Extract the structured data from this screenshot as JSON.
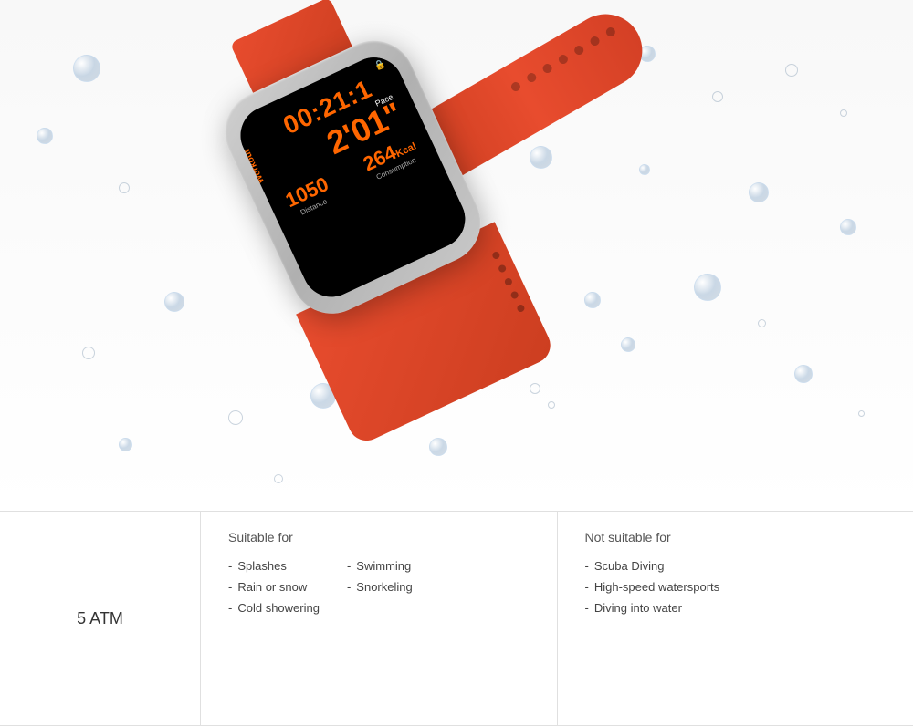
{
  "watch": {
    "screen": {
      "workout_label": "Workout",
      "lock_icon": "🔒",
      "time_elapsed": "00:21:1",
      "pace_label": "Pace",
      "pace_value": "2'01\"",
      "distance_value": "1050",
      "distance_label": "Distance",
      "kcal_value": "264",
      "kcal_unit": "Kcal",
      "consumption_label": "Consumption"
    },
    "band_color": "#e84c2e"
  },
  "table": {
    "atm_label": "5 ATM",
    "suitable_header": "Suitable for",
    "not_suitable_header": "Not suitable for",
    "suitable_col1": [
      "Splashes",
      "Rain or snow",
      "Cold showering"
    ],
    "suitable_col2": [
      "Swimming",
      "Snorkeling"
    ],
    "not_suitable": [
      "Scuba Diving",
      "High-speed watersports",
      "Diving into water"
    ]
  },
  "drops": [
    {
      "class": "d1 drop-chrome",
      "size": "large"
    },
    {
      "class": "d2 drop-chrome",
      "size": "medium"
    },
    {
      "class": "d3 drop-small-circle",
      "size": "small"
    },
    {
      "class": "d4 drop-chrome",
      "size": "medium"
    },
    {
      "class": "d5 drop-small-circle",
      "size": "small"
    },
    {
      "class": "d6 drop-chrome",
      "size": "large"
    },
    {
      "class": "d7 drop-chrome",
      "size": "medium"
    },
    {
      "class": "d8 drop-chrome",
      "size": "large"
    },
    {
      "class": "d9 drop-small-circle",
      "size": "small"
    },
    {
      "class": "d10 drop-chrome",
      "size": "medium"
    },
    {
      "class": "d11 drop-chrome",
      "size": "medium"
    },
    {
      "class": "d12 drop-small-circle",
      "size": "small"
    },
    {
      "class": "d13 drop-chrome",
      "size": "medium"
    },
    {
      "class": "d14 drop-chrome",
      "size": "large"
    },
    {
      "class": "d15 drop-chrome",
      "size": "medium"
    },
    {
      "class": "d16 drop-small-circle",
      "size": "small"
    },
    {
      "class": "d17 drop-chrome",
      "size": "medium"
    },
    {
      "class": "d18 drop-small-circle",
      "size": "small"
    },
    {
      "class": "d19 drop-small-circle",
      "size": "tiny"
    },
    {
      "class": "d20 drop-chrome",
      "size": "medium"
    }
  ]
}
